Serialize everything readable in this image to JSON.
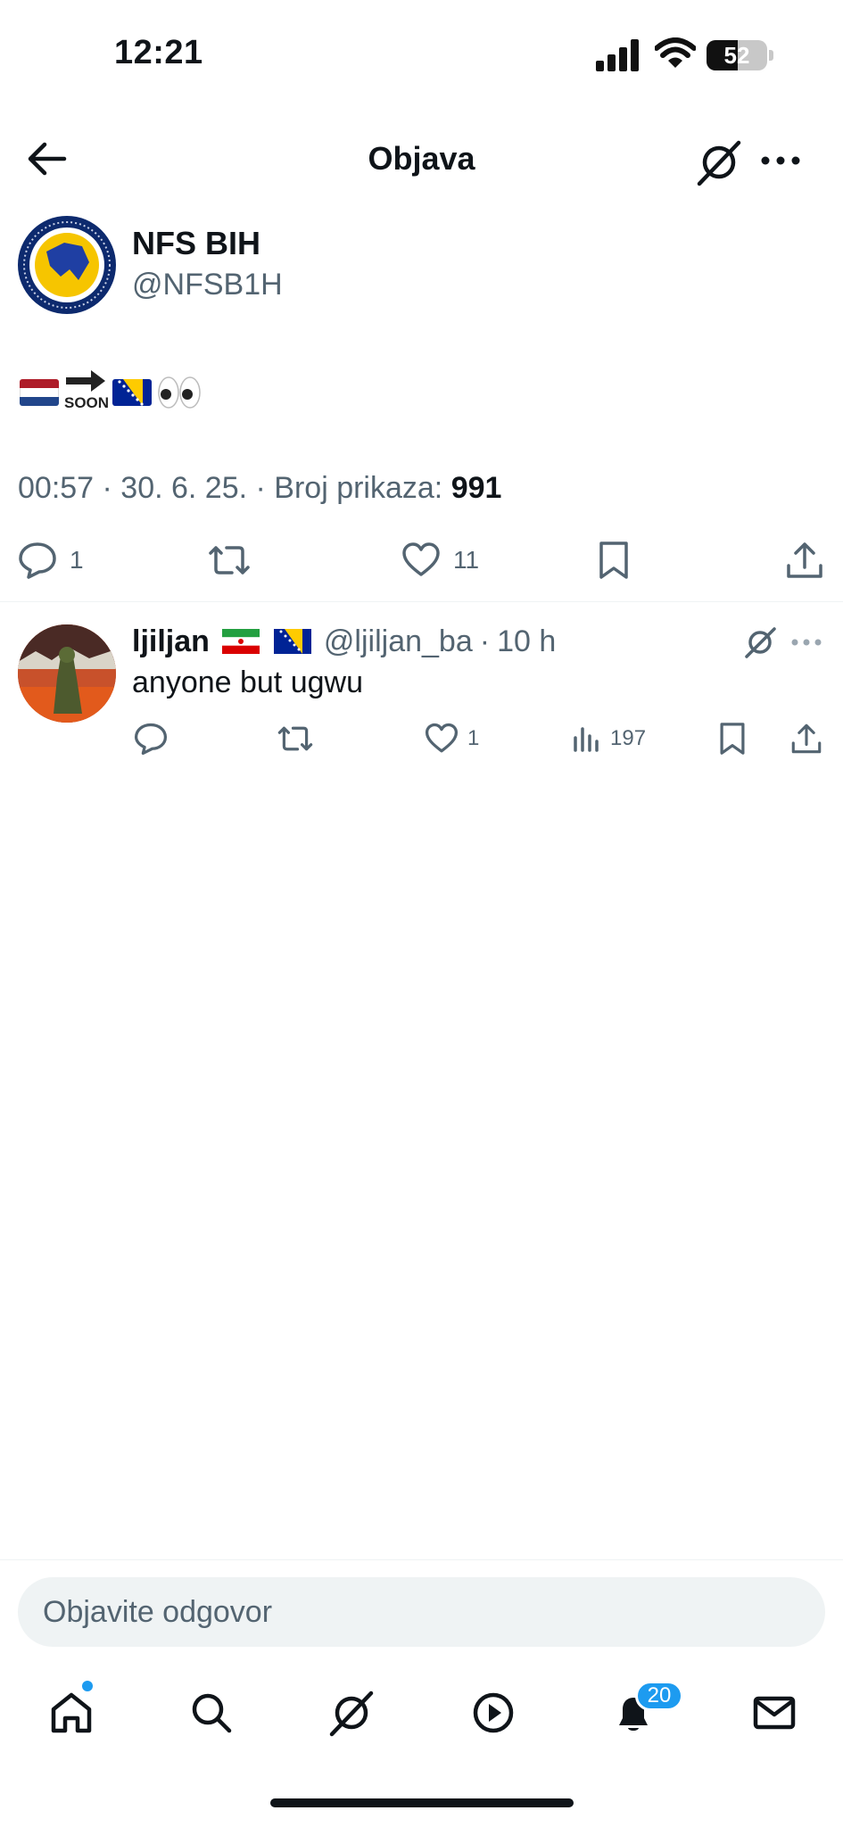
{
  "status_bar": {
    "time": "12:21",
    "battery": "52",
    "battery_level": 0.52
  },
  "header": {
    "title": "Objava"
  },
  "post": {
    "author_name": "NFS BIH",
    "author_handle": "@NFSB1H",
    "emoji_content": [
      "flag-netherlands",
      "soon-arrow",
      "flag-bosnia",
      "eyes"
    ],
    "soon_label": "SOON",
    "meta_prefix": "00:57 · 30. 6. 25. · Broj prikaza: ",
    "views": "991",
    "actions": {
      "replies": "1",
      "likes": "11"
    }
  },
  "reply": {
    "author_name": "ljiljan",
    "author_flags": [
      "flag-iran",
      "flag-bosnia"
    ],
    "author_handle": "@ljiljan_ba",
    "separator": "·",
    "time": "10 h",
    "text": "anyone but ugwu",
    "actions": {
      "likes": "1",
      "views": "197"
    }
  },
  "composer": {
    "placeholder": "Objavite odgovor"
  },
  "bottom_nav": {
    "items": [
      "home",
      "search",
      "grok",
      "video",
      "notifications",
      "messages"
    ],
    "notifications_badge": "20"
  },
  "colors": {
    "text": "#0f1419",
    "secondary": "#536471",
    "accent": "#1d9bf0",
    "divider": "#eff3f4"
  }
}
